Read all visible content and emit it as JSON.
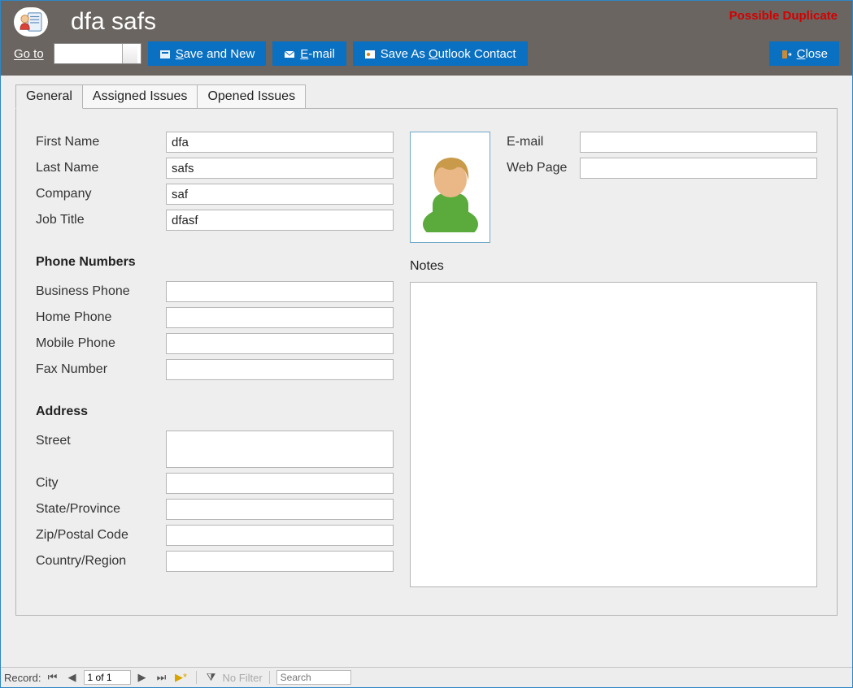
{
  "header": {
    "title": "dfa safs",
    "duplicate_warning": "Possible Duplicate"
  },
  "toolbar": {
    "goto_label_pre": "G",
    "goto_label_rest": "o to",
    "goto_value": "",
    "save_new": "Save and New",
    "save_new_key": "S",
    "email": "E-mail",
    "email_key": "E",
    "save_outlook_pre": "Save As ",
    "save_outlook_key": "O",
    "save_outlook_post": "utlook Contact",
    "close": "Close",
    "close_key": "C"
  },
  "tabs": {
    "general": "General",
    "assigned": "Assigned Issues",
    "opened": "Opened Issues"
  },
  "form": {
    "first_name_label": "First Name",
    "first_name": "dfa",
    "last_name_label": "Last Name",
    "last_name": "safs",
    "company_label": "Company",
    "company": "saf",
    "job_title_label": "Job Title",
    "job_title": "dfasf",
    "phone_section": "Phone Numbers",
    "business_phone_label": "Business Phone",
    "business_phone": "",
    "home_phone_label": "Home Phone",
    "home_phone": "",
    "mobile_phone_label": "Mobile Phone",
    "mobile_phone": "",
    "fax_label": "Fax Number",
    "fax": "",
    "address_section": "Address",
    "street_label": "Street",
    "street": "",
    "city_label": "City",
    "city": "",
    "state_label": "State/Province",
    "state": "",
    "zip_label": "Zip/Postal Code",
    "zip": "",
    "country_label": "Country/Region",
    "country": "",
    "email_label": "E-mail",
    "email": "",
    "webpage_label": "Web Page",
    "webpage": "",
    "notes_label": "Notes",
    "notes": ""
  },
  "statusbar": {
    "record_label": "Record:",
    "position": "1 of 1",
    "no_filter": "No Filter",
    "search_placeholder": "Search"
  }
}
